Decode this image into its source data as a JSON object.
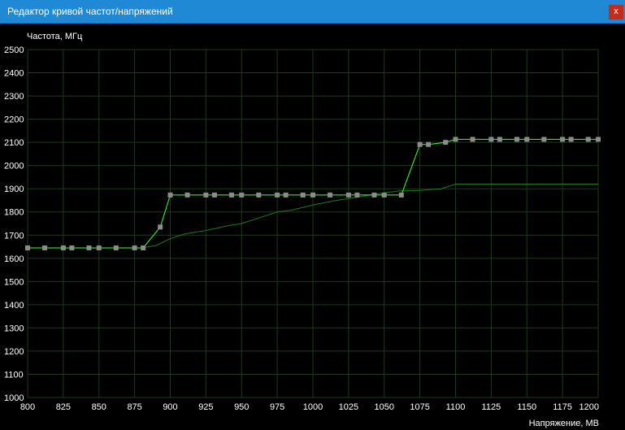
{
  "window": {
    "title": "Редактор кривой частот/напряжений",
    "close_label": "x"
  },
  "chart_data": {
    "type": "line",
    "ylabel": "Частота, МГц",
    "xlabel": "Напряжение, МВ",
    "xlim": [
      800,
      1200
    ],
    "ylim": [
      1000,
      2500
    ],
    "x_ticks": [
      800,
      825,
      850,
      875,
      900,
      925,
      950,
      975,
      1000,
      1025,
      1050,
      1075,
      1100,
      1125,
      1150,
      1175,
      1200
    ],
    "y_ticks": [
      1000,
      1100,
      1200,
      1300,
      1400,
      1500,
      1600,
      1700,
      1800,
      1900,
      2000,
      2100,
      2200,
      2300,
      2400,
      2500
    ],
    "grid": true,
    "series": [
      {
        "role": "curve",
        "color": "#3cff3c",
        "markers": true,
        "marker_color": "#8c8c8c",
        "x": [
          800,
          812,
          825,
          831,
          843,
          850,
          862,
          875,
          881,
          893,
          900,
          912,
          925,
          931,
          943,
          950,
          962,
          975,
          981,
          993,
          1000,
          1012,
          1025,
          1031,
          1043,
          1050,
          1062,
          1075,
          1081,
          1093,
          1100,
          1112,
          1125,
          1131,
          1143,
          1150,
          1162,
          1175,
          1181,
          1193,
          1200
        ],
        "y": [
          1645,
          1645,
          1645,
          1645,
          1645,
          1645,
          1645,
          1645,
          1645,
          1735,
          1873,
          1873,
          1873,
          1873,
          1873,
          1873,
          1873,
          1873,
          1873,
          1873,
          1873,
          1873,
          1873,
          1873,
          1873,
          1873,
          1873,
          2091,
          2091,
          2100,
          2113,
          2113,
          2113,
          2113,
          2113,
          2113,
          2113,
          2113,
          2113,
          2113,
          2113
        ]
      },
      {
        "role": "reference",
        "color": "#1f7a1f",
        "markers": false,
        "x": [
          800,
          880,
          890,
          900,
          910,
          925,
          940,
          950,
          960,
          975,
          985,
          1000,
          1015,
          1030,
          1045,
          1060,
          1075,
          1090,
          1100,
          1200
        ],
        "y": [
          1645,
          1645,
          1655,
          1685,
          1705,
          1720,
          1740,
          1750,
          1770,
          1800,
          1808,
          1830,
          1848,
          1862,
          1878,
          1890,
          1893,
          1900,
          1920,
          1920
        ]
      }
    ]
  }
}
